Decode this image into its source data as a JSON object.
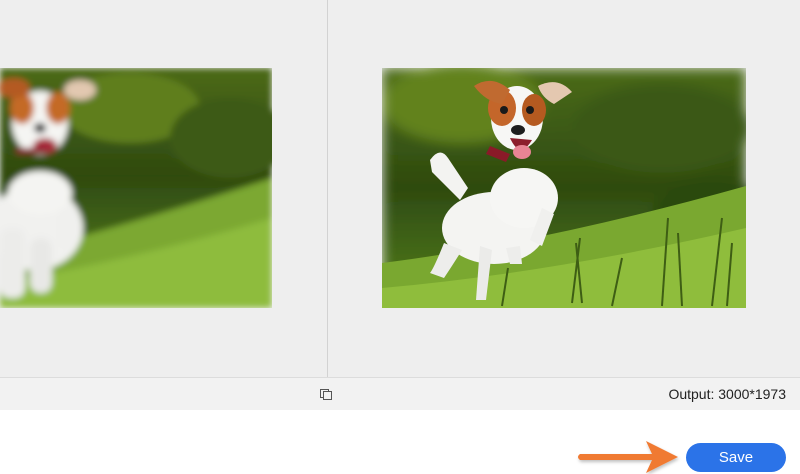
{
  "status_bar": {
    "output_label": "Output: 3000*1973",
    "compare_icon": "compare-squares-icon"
  },
  "actions": {
    "save_label": "Save",
    "arrow_icon": "orange-arrow-right-icon"
  },
  "colors": {
    "accent": "#2b73e8",
    "arrow": "#f07a32",
    "panel_bg": "#eeeeee"
  }
}
